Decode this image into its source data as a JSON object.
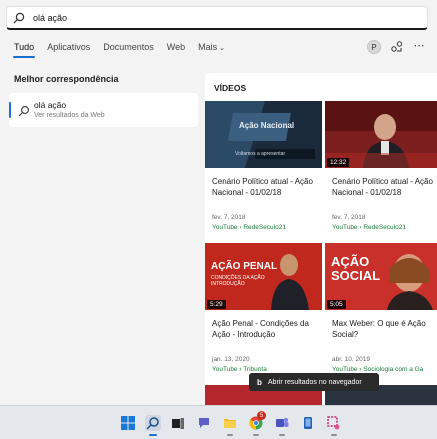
{
  "search": {
    "query": "olá ação"
  },
  "tabs": [
    {
      "label": "Tudo",
      "active": true
    },
    {
      "label": "Aplicativos"
    },
    {
      "label": "Documentos"
    },
    {
      "label": "Web"
    },
    {
      "label": "Mais"
    }
  ],
  "account": {
    "initial": "P"
  },
  "best_match": {
    "heading": "Melhor correspondência",
    "title": "olá ação",
    "subtitle": "Ver resultados da Web"
  },
  "videos": {
    "heading": "VÍDEOS",
    "items": [
      {
        "duration": "",
        "title": "Cenário Político atual - Ação Nacional - 01/02/18",
        "date": "fev. 7, 2018",
        "source": "YouTube › RedeSeculo21",
        "thumb_caption": "Ação Nacional",
        "thumb_sub": "Voltamos a apresentar"
      },
      {
        "duration": "12:32",
        "title": "Cenário Político atual - Ação Nacional - 01/02/18",
        "date": "fev. 7, 2018",
        "source": "YouTube › RedeSeculo21"
      },
      {
        "duration": "5:29",
        "title": "Ação Penal - Condições da Ação - Introdução",
        "date": "jan. 13, 2020",
        "source": "YouTube › Tribunta",
        "thumb_caption": "AÇÃO PENAL",
        "thumb_sub": "CONDIÇÕES DA AÇÃO INTRODUÇÃO"
      },
      {
        "duration": "5:05",
        "title": "Max Weber: O que é Ação Social?",
        "date": "abr. 10, 2019",
        "source": "YouTube › Sociologia com a Ga",
        "thumb_caption": "AÇÃO SOCIAL"
      }
    ]
  },
  "toast": {
    "logo": "b",
    "text": "Abrir resultados no navegador"
  },
  "taskbar": {
    "icons": [
      "windows-start-icon",
      "search-icon",
      "task-view-icon",
      "chat-icon",
      "file-explorer-icon",
      "chrome-icon",
      "teams-icon",
      "phone-icon",
      "snipping-tool-icon"
    ],
    "badge": "5"
  },
  "colors": {
    "accent": "#1a6fd0",
    "source_green": "#1a7a3a",
    "thumb_red": "#c0281e"
  }
}
